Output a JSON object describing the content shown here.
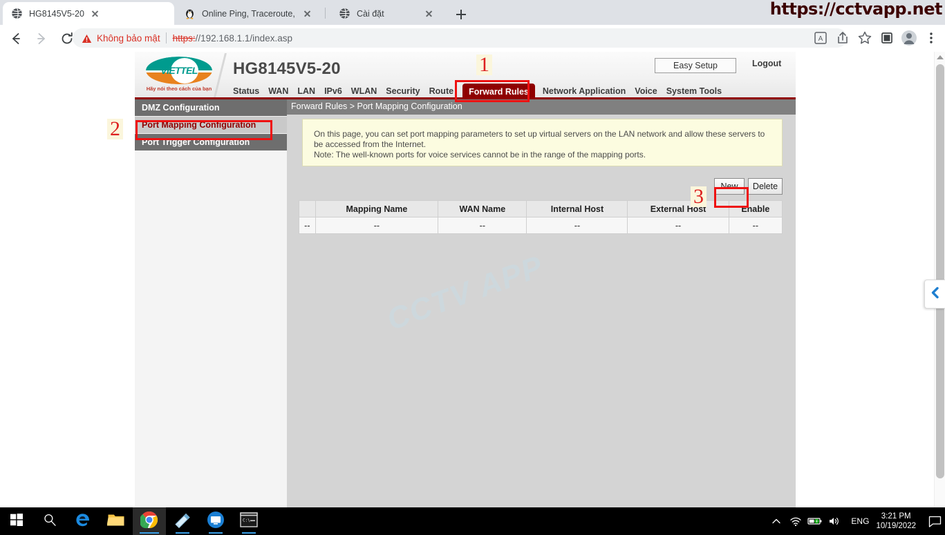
{
  "browser": {
    "tabs": [
      {
        "title": "HG8145V5-20",
        "favicon": "globe-icon",
        "active": true
      },
      {
        "title": "Online Ping, Traceroute, DNS loo",
        "favicon": "penguin-icon",
        "active": false
      },
      {
        "title": "Cài đặt",
        "favicon": "globe-icon",
        "active": false
      }
    ],
    "new_tab_label": "+",
    "nav": {
      "back": "back-arrow-icon",
      "forward": "forward-arrow-icon",
      "reload": "reload-icon"
    },
    "omnibox": {
      "security_warning": "Không bảo mật",
      "scheme": "https:",
      "url_rest": "//192.168.1.1/index.asp",
      "full_url": "https://192.168.1.1/index.asp"
    },
    "toolbar_icons": [
      "translate-icon",
      "share-icon",
      "bookmark-star-icon",
      "side-panel-icon",
      "profile-avatar-icon",
      "chrome-menu-icon"
    ]
  },
  "watermarks": {
    "top_right_url": "https://cctvapp.net",
    "center": "CCTV APP"
  },
  "router": {
    "product_title": "HG8145V5-20",
    "logo": {
      "wordmark": "VIETTEL",
      "tagline": "Hãy nói theo cách của bạn"
    },
    "top_buttons": {
      "easy_setup": "Easy Setup",
      "logout": "Logout"
    },
    "nav_items": [
      {
        "label": "Status",
        "selected": false
      },
      {
        "label": "WAN",
        "selected": false
      },
      {
        "label": "LAN",
        "selected": false
      },
      {
        "label": "IPv6",
        "selected": false
      },
      {
        "label": "WLAN",
        "selected": false
      },
      {
        "label": "Security",
        "selected": false
      },
      {
        "label": "Route",
        "selected": false
      },
      {
        "label": "Forward Rules",
        "selected": true
      },
      {
        "label": "Network Application",
        "selected": false
      },
      {
        "label": "Voice",
        "selected": false
      },
      {
        "label": "System Tools",
        "selected": false
      }
    ],
    "breadcrumb": "Forward Rules > Port Mapping Configuration",
    "sidebar_items": [
      {
        "label": "DMZ Configuration",
        "selected": false
      },
      {
        "label": "Port Mapping Configuration",
        "selected": true
      },
      {
        "label": "Port Trigger Configuration",
        "selected": false
      }
    ],
    "note": {
      "line1": "On this page, you can set port mapping parameters to set up virtual servers on the LAN network and allow these servers to be accessed from the Internet.",
      "line2": "Note: The well-known ports for voice services cannot be in the range of the mapping ports."
    },
    "table_buttons": {
      "new": "New",
      "delete": "Delete"
    },
    "table": {
      "headers": [
        "",
        "Mapping Name",
        "WAN Name",
        "Internal Host",
        "External Host",
        "Enable"
      ],
      "rows": [
        [
          "--",
          "--",
          "--",
          "--",
          "--",
          "--"
        ]
      ]
    }
  },
  "annotations": [
    {
      "number": "1",
      "target": "forward-rules-nav-tab"
    },
    {
      "number": "2",
      "target": "port-mapping-configuration-sidebar-item"
    },
    {
      "number": "3",
      "target": "new-button"
    }
  ],
  "accent_colors": {
    "viettel_red": "#8f0000",
    "annotation_red": "#ee1111",
    "logo_teal": "#009b8e",
    "logo_orange": "#e8821e",
    "note_bg": "#fcfce0"
  },
  "taskbar": {
    "items": [
      {
        "name": "start-button",
        "icon": "windows-logo-icon"
      },
      {
        "name": "search-button",
        "icon": "search-icon"
      },
      {
        "name": "edge-button",
        "icon": "edge-icon"
      },
      {
        "name": "file-explorer-button",
        "icon": "folder-icon"
      },
      {
        "name": "chrome-button",
        "icon": "chrome-icon"
      },
      {
        "name": "editor-button",
        "icon": "notepad-icon"
      },
      {
        "name": "remote-desktop-button",
        "icon": "monitor-circle-icon"
      },
      {
        "name": "terminal-button",
        "icon": "command-prompt-icon"
      }
    ],
    "tray": {
      "show_hidden": "chevron-up-icon",
      "network": "wifi-icon",
      "battery": "battery-charging-icon",
      "volume": "speaker-icon",
      "language": "ENG",
      "time": "3:21 PM",
      "date": "10/19/2022",
      "action_center": "notification-icon"
    }
  }
}
